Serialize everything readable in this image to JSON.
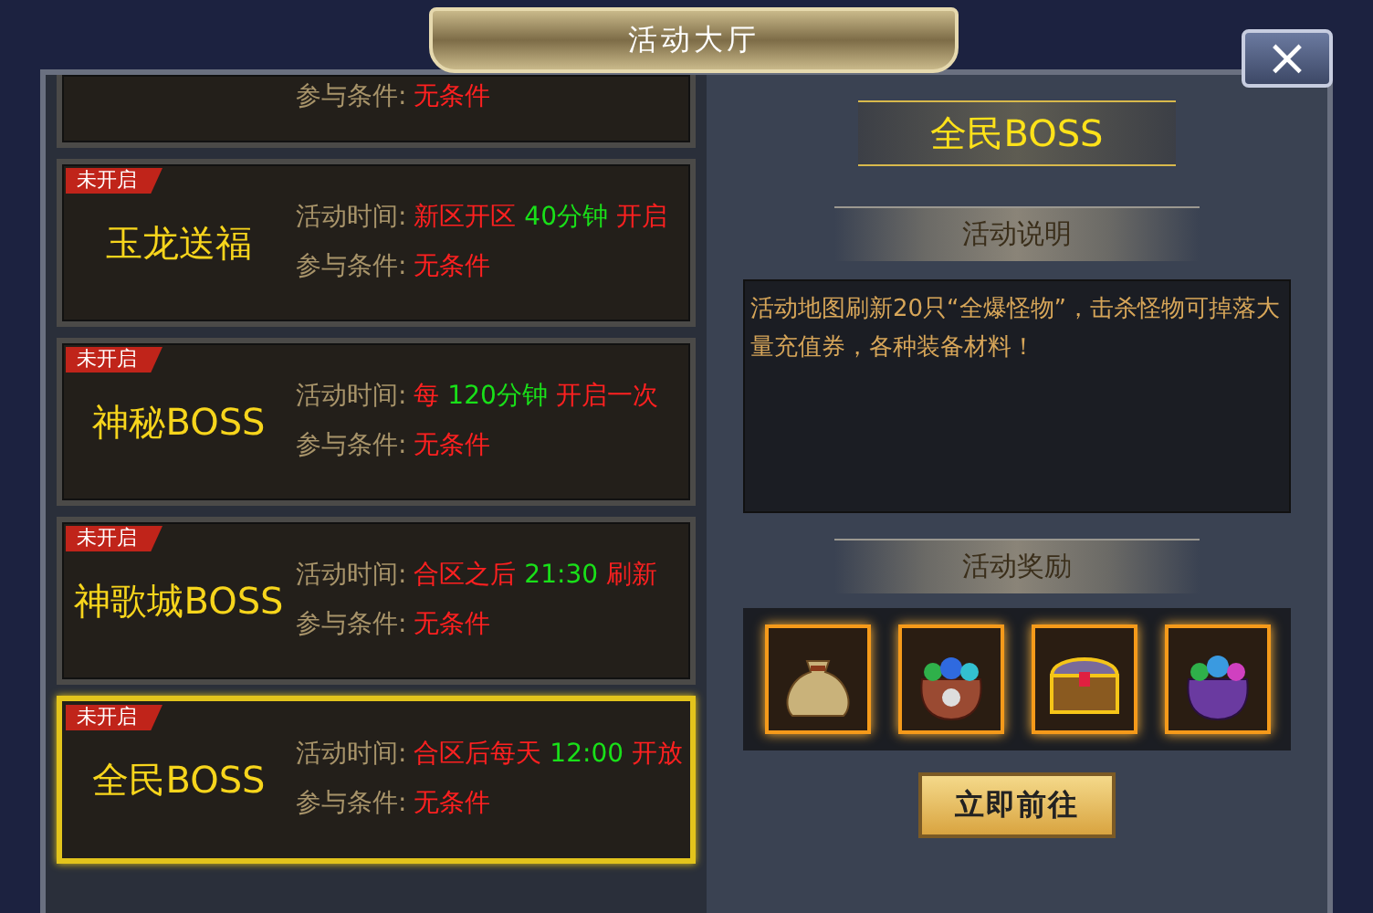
{
  "window": {
    "title": "活动大厅",
    "close": "×"
  },
  "activities": [
    {
      "partial": true,
      "condition_label": "参与条件:",
      "condition": "无条件",
      "selected": false
    },
    {
      "partial": false,
      "status": "未开启",
      "name": "玉龙送福",
      "time_label": "活动时间:",
      "time": [
        {
          "text": "新区开区",
          "kind": "plain"
        },
        {
          "text": "40分钟",
          "kind": "highlight"
        },
        {
          "text": "开启",
          "kind": "plain"
        }
      ],
      "condition_label": "参与条件:",
      "condition": "无条件",
      "selected": false
    },
    {
      "partial": false,
      "status": "未开启",
      "name": "神秘BOSS",
      "time_label": "活动时间:",
      "time": [
        {
          "text": "每",
          "kind": "plain"
        },
        {
          "text": "120分钟",
          "kind": "highlight"
        },
        {
          "text": "开启一次",
          "kind": "plain"
        }
      ],
      "condition_label": "参与条件:",
      "condition": "无条件",
      "selected": false
    },
    {
      "partial": false,
      "status": "未开启",
      "name": "神歌城BOSS",
      "time_label": "活动时间:",
      "time": [
        {
          "text": "合区之后",
          "kind": "plain"
        },
        {
          "text": "21:30",
          "kind": "highlight"
        },
        {
          "text": "刷新",
          "kind": "plain"
        }
      ],
      "condition_label": "参与条件:",
      "condition": "无条件",
      "selected": false
    },
    {
      "partial": false,
      "status": "未开启",
      "name": "全民BOSS",
      "time_label": "活动时间:",
      "time": [
        {
          "text": "合区后每天",
          "kind": "plain"
        },
        {
          "text": "12:00",
          "kind": "highlight"
        },
        {
          "text": "开放",
          "kind": "plain"
        }
      ],
      "condition_label": "参与条件:",
      "condition": "无条件",
      "selected": true
    }
  ],
  "detail": {
    "title": "全民BOSS",
    "description_header": "活动说明",
    "description": "活动地图刷新20只“全爆怪物”，击杀怪物可掉落大量充值券，各种装备材料！",
    "rewards_header": "活动奖励",
    "rewards": [
      {
        "kind": "sack"
      },
      {
        "kind": "gem-bag"
      },
      {
        "kind": "chest"
      },
      {
        "kind": "purple-bag"
      }
    ],
    "button": "立即前往"
  }
}
